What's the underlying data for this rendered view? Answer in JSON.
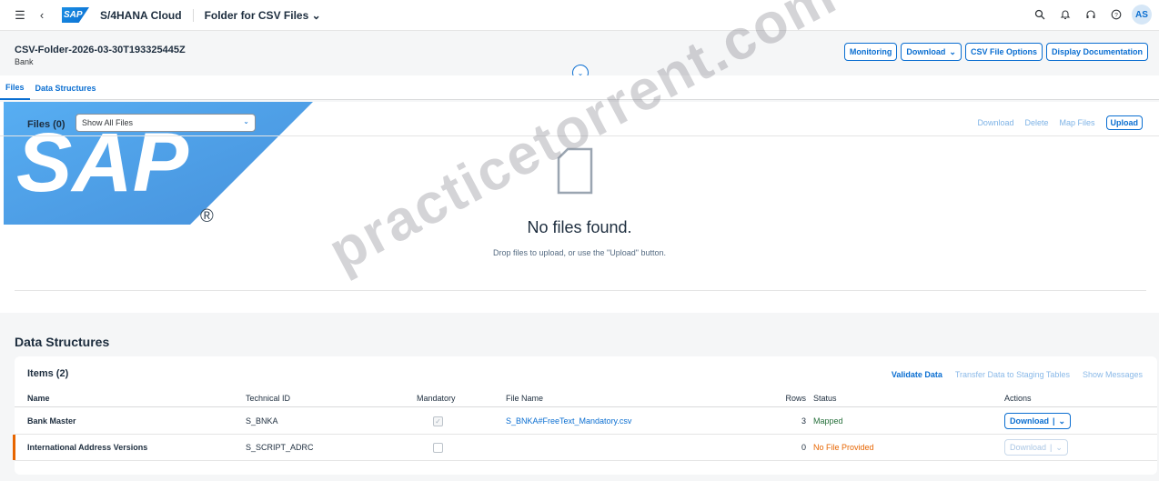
{
  "shell": {
    "product": "S/4HANA Cloud",
    "app_title": "Folder for CSV Files",
    "logo_text": "SAP",
    "avatar": "AS",
    "icons": [
      "menu-icon",
      "back-icon",
      "search-icon",
      "bell-icon",
      "headset-icon",
      "help-icon"
    ]
  },
  "header": {
    "title": "CSV-Folder-2026-03-30T193325445Z",
    "subtitle": "Bank",
    "actions": {
      "monitoring": "Monitoring",
      "download": "Download",
      "csv_options": "CSV File Options",
      "display_doc": "Display Documentation"
    }
  },
  "tabs": [
    "Files",
    "Data Structures"
  ],
  "files": {
    "title": "Files (0)",
    "filter": "Show All Files",
    "actions": {
      "download": "Download",
      "delete": "Delete",
      "map_files": "Map Files",
      "upload": "Upload"
    },
    "empty_title": "No files found.",
    "empty_sub": "Drop files to upload, or use the \"Upload\" button."
  },
  "watermark": "practicetorrent.com",
  "data_structures": {
    "heading": "Data Structures",
    "items_title": "Items (2)",
    "actions": {
      "validate": "Validate Data",
      "transfer": "Transfer Data to Staging Tables",
      "messages": "Show Messages"
    },
    "columns": {
      "name": "Name",
      "tech_id": "Technical ID",
      "mandatory": "Mandatory",
      "file_name": "File Name",
      "rows": "Rows",
      "status": "Status",
      "actions": "Actions"
    },
    "rows": [
      {
        "name": "Bank Master",
        "tech_id": "S_BNKA",
        "mandatory": true,
        "file_name": "S_BNKA#FreeText_Mandatory.csv",
        "rows": "3",
        "status": "Mapped",
        "action": "Download"
      },
      {
        "name": "International Address Versions",
        "tech_id": "S_SCRIPT_ADRC",
        "mandatory": false,
        "file_name": "",
        "rows": "0",
        "status": "No File Provided",
        "action": "Download"
      }
    ]
  },
  "colors": {
    "accent": "#0a6ed1",
    "mapped": "#256f3a",
    "warning": "#e76500"
  }
}
